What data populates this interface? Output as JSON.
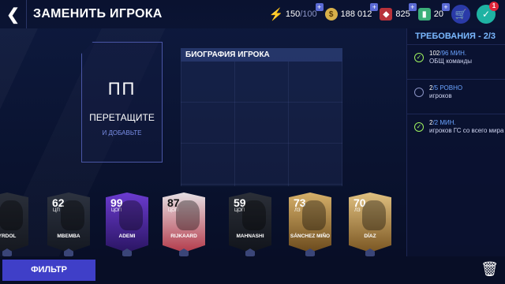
{
  "header": {
    "title": "ЗАМЕНИТЬ ИГРОКА",
    "back_icon": "chevron-left-icon"
  },
  "currencies": {
    "energy": {
      "value": "150",
      "max": "/100"
    },
    "coins": {
      "value": "188 012"
    },
    "gems": {
      "value": "825"
    },
    "cash": {
      "value": "20"
    }
  },
  "notifications": {
    "objectives_badge": "1"
  },
  "drop_slot": {
    "position": "ПП",
    "drag_text": "ПЕРЕТАЩИТЕ",
    "add_text": "И ДОБАВЬТЕ"
  },
  "bio": {
    "title": "БИОГРАФИЯ ИГРОКА"
  },
  "requirements": {
    "title": "ТРЕБОВАНИЯ - 2/3",
    "items": [
      {
        "count": "102",
        "target": "/96 МИН.",
        "desc": "ОБЩ команды",
        "done": true
      },
      {
        "count": "2",
        "target": "/5 РОВНО",
        "desc": "игроков",
        "done": false
      },
      {
        "count": "2",
        "target": "/2 МИН.",
        "desc": "игроков ГС со всего мира",
        "done": true
      }
    ]
  },
  "cards": [
    {
      "rating": "",
      "pos": "",
      "name": "YRDOL"
    },
    {
      "rating": "62",
      "pos": "ЦП",
      "name": "MBEMBA"
    },
    {
      "rating": "99",
      "pos": "ЦОП",
      "name": "ADEMI"
    },
    {
      "rating": "87",
      "pos": "ЦОП",
      "name": "RIJKAARD"
    },
    {
      "rating": "59",
      "pos": "ЦОП",
      "name": "MAHNASHI"
    },
    {
      "rating": "73",
      "pos": "ЛЗ",
      "name": "SÁNCHEZ MIÑO"
    },
    {
      "rating": "70",
      "pos": "ЛЗ",
      "name": "DÍAZ"
    }
  ],
  "card_styles": [
    "c-green",
    "c-black",
    "c-purple",
    "c-red",
    "c-black2",
    "c-gold",
    "c-gold2"
  ],
  "footer": {
    "filter_label": "ФИЛЬТР"
  },
  "colors": {
    "accent": "#3f3fc8",
    "req_title": "#7ab8ff",
    "check": "#9ef25f"
  }
}
